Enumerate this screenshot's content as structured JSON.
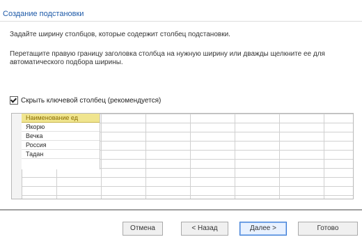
{
  "window": {
    "title": "Создание подстановки"
  },
  "instructions": {
    "line1": "Задайте ширину столбцов, которые содержит столбец подстановки.",
    "line2": "Перетащите правую границу заголовка столбца на нужную ширину или дважды щелкните ее для автоматического подбора ширины."
  },
  "checkbox": {
    "label": "Скрыть ключевой столбец (рекомендуется)",
    "checked": true
  },
  "grid": {
    "column_header": "Наименование ед",
    "rows": [
      "Якорю",
      "Вечка",
      "Россия",
      "Тадан"
    ]
  },
  "buttons": {
    "cancel": "Отмена",
    "back": "< Назад",
    "next": "Далее >",
    "finish": "Готово"
  }
}
